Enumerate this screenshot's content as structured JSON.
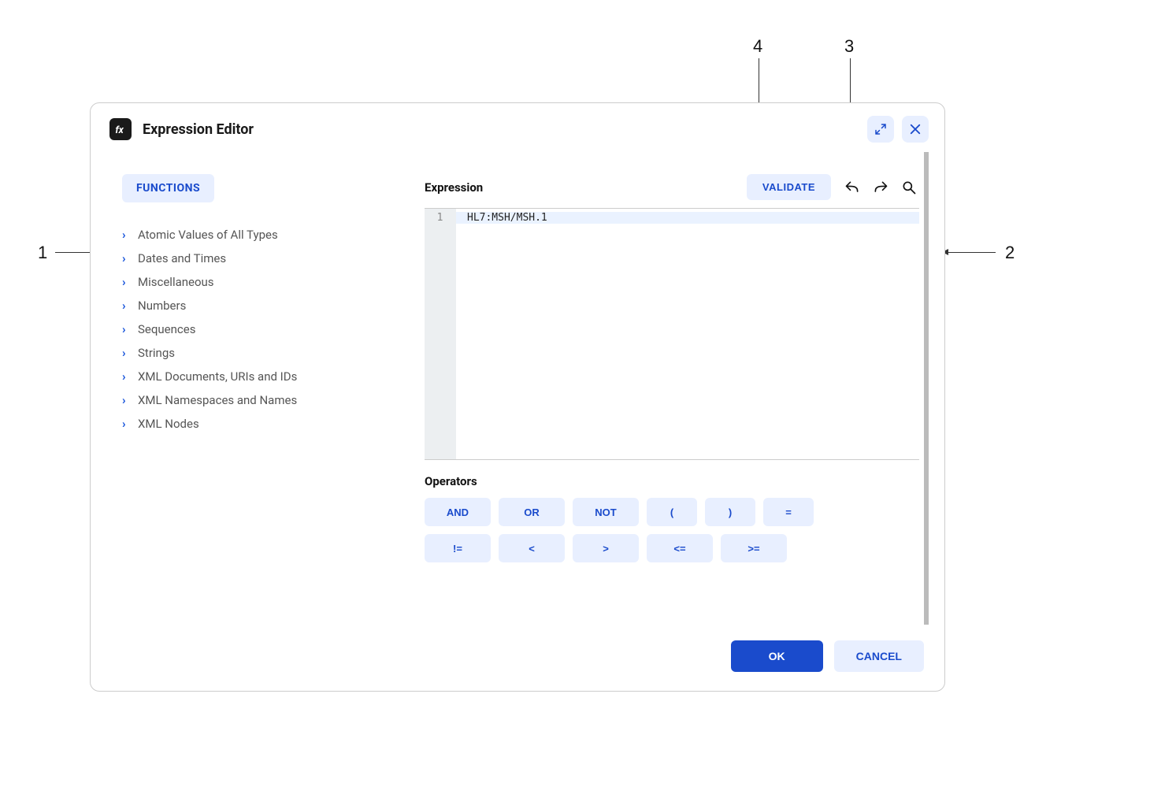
{
  "dialog": {
    "title": "Expression Editor"
  },
  "sidebar": {
    "tab_label": "FUNCTIONS",
    "items": [
      {
        "label": "Atomic Values of All Types"
      },
      {
        "label": "Dates and Times"
      },
      {
        "label": "Miscellaneous"
      },
      {
        "label": "Numbers"
      },
      {
        "label": "Sequences"
      },
      {
        "label": "Strings"
      },
      {
        "label": "XML Documents, URIs and IDs"
      },
      {
        "label": "XML Namespaces and Names"
      },
      {
        "label": "XML Nodes"
      }
    ]
  },
  "expression": {
    "label": "Expression",
    "validate_label": "VALIDATE",
    "line_number": "1",
    "code": "HL7:MSH/MSH.1"
  },
  "operators": {
    "label": "Operators",
    "row1": [
      "AND",
      "OR",
      "NOT",
      "(",
      ")",
      "="
    ],
    "row2": [
      "!=",
      "<",
      ">",
      "<=",
      ">="
    ]
  },
  "footer": {
    "ok": "OK",
    "cancel": "CANCEL"
  },
  "callouts": {
    "c1": "1",
    "c2": "2",
    "c3": "3",
    "c4": "4"
  }
}
